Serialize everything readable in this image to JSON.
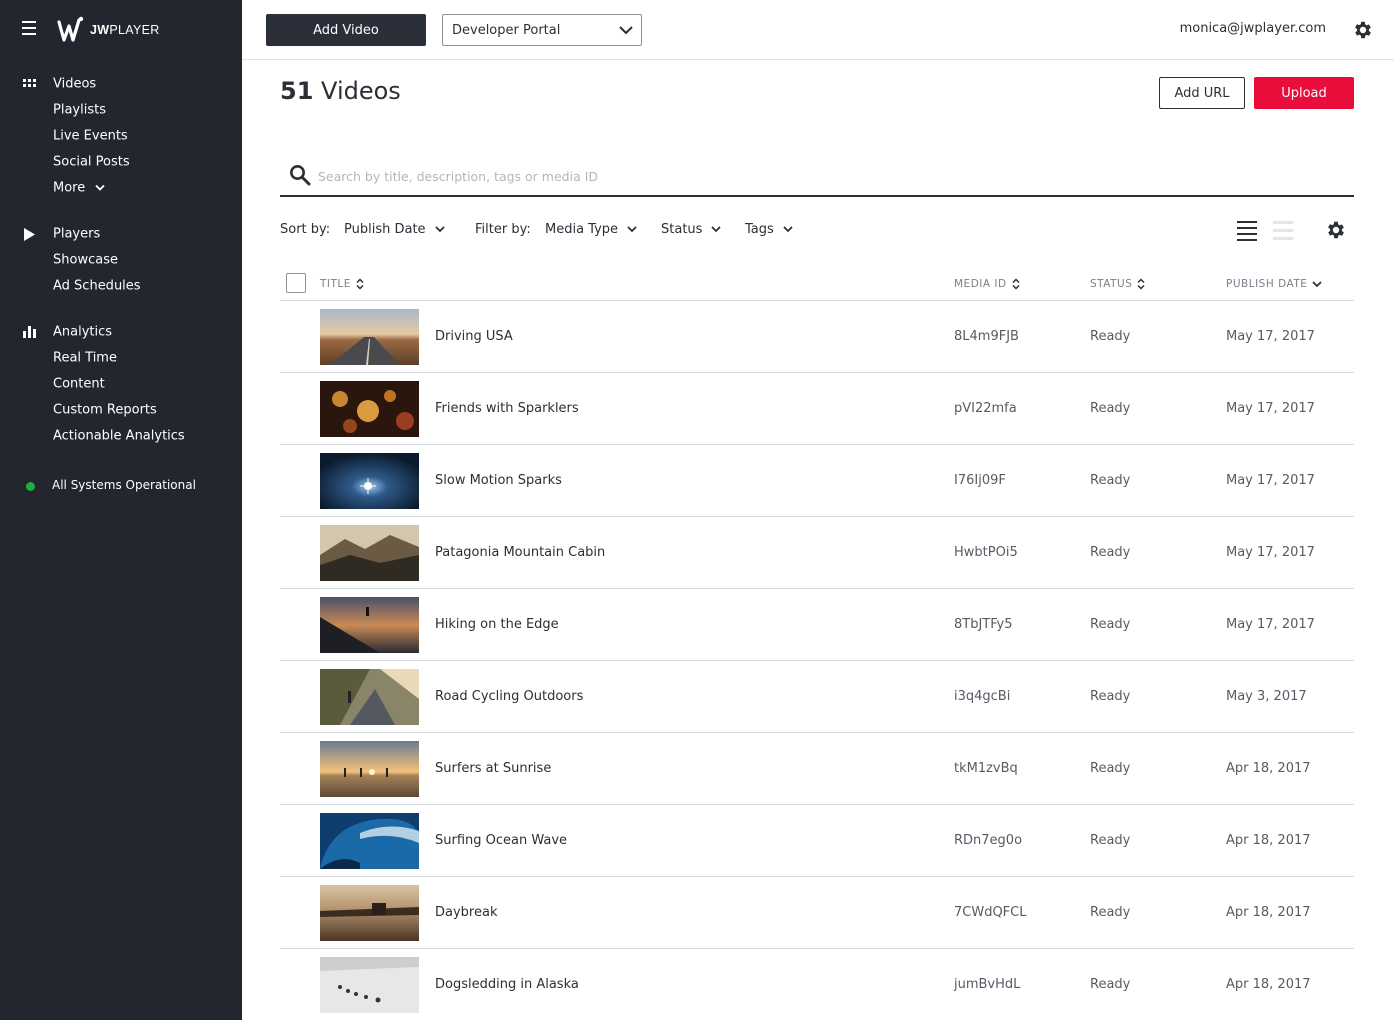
{
  "brand": {
    "logo_text_bold": "JW",
    "logo_text": "PLAYER"
  },
  "sidebar": {
    "groups": [
      {
        "icon": "grid-icon",
        "items": [
          {
            "label": "Videos"
          },
          {
            "label": "Playlists"
          },
          {
            "label": "Live Events"
          },
          {
            "label": "Social Posts"
          },
          {
            "label": "More"
          }
        ]
      },
      {
        "icon": "play-icon",
        "items": [
          {
            "label": "Players"
          },
          {
            "label": "Showcase"
          },
          {
            "label": "Ad Schedules"
          }
        ]
      },
      {
        "icon": "bar-chart-icon",
        "items": [
          {
            "label": "Analytics"
          },
          {
            "label": "Real Time"
          },
          {
            "label": "Content"
          },
          {
            "label": "Custom Reports"
          },
          {
            "label": "Actionable Analytics"
          }
        ]
      }
    ],
    "status": {
      "label": "All Systems Operational",
      "color": "#1fad3d"
    }
  },
  "topbar": {
    "add_video_label": "Add Video",
    "property_value": "Developer Portal",
    "user_email": "monica@jwplayer.com"
  },
  "main": {
    "title_count": "51",
    "title_text": "Videos",
    "add_url_label": "Add URL",
    "upload_label": "Upload",
    "search_placeholder": "Search by title, description, tags or media ID",
    "sort_label": "Sort by:",
    "sort_value": "Publish Date",
    "filter_label": "Filter by:",
    "filters": [
      "Media Type",
      "Status",
      "Tags"
    ]
  },
  "table": {
    "columns": {
      "title": "TITLE",
      "media_id": "MEDIA ID",
      "status": "STATUS",
      "publish_date": "PUBLISH DATE"
    },
    "rows": [
      {
        "title": "Driving USA",
        "media_id": "8L4m9FJB",
        "status": "Ready",
        "date": "May 17, 2017",
        "thumb": "desert-road"
      },
      {
        "title": "Friends with Sparklers",
        "media_id": "pVI22mfa",
        "status": "Ready",
        "date": "May 17, 2017",
        "thumb": "sparklers"
      },
      {
        "title": "Slow Motion Sparks",
        "media_id": "I76Ij09F",
        "status": "Ready",
        "date": "May 17, 2017",
        "thumb": "sparks"
      },
      {
        "title": "Patagonia Mountain Cabin",
        "media_id": "HwbtPOi5",
        "status": "Ready",
        "date": "May 17, 2017",
        "thumb": "mountains"
      },
      {
        "title": "Hiking on the Edge",
        "media_id": "8TbJTFy5",
        "status": "Ready",
        "date": "May 17, 2017",
        "thumb": "hiking"
      },
      {
        "title": "Road Cycling Outdoors",
        "media_id": "i3q4gcBi",
        "status": "Ready",
        "date": "May 3, 2017",
        "thumb": "cycling"
      },
      {
        "title": "Surfers at Sunrise",
        "media_id": "tkM1zvBq",
        "status": "Ready",
        "date": "Apr 18, 2017",
        "thumb": "sunrise-beach"
      },
      {
        "title": "Surfing Ocean Wave",
        "media_id": "RDn7eg0o",
        "status": "Ready",
        "date": "Apr 18, 2017",
        "thumb": "wave"
      },
      {
        "title": "Daybreak",
        "media_id": "7CWdQFCL",
        "status": "Ready",
        "date": "Apr 18, 2017",
        "thumb": "daybreak"
      },
      {
        "title": "Dogsledding in Alaska",
        "media_id": "jumBvHdL",
        "status": "Ready",
        "date": "Apr 18, 2017",
        "thumb": "snow"
      }
    ]
  },
  "colors": {
    "sidebar_bg": "#23262e",
    "primary_dark": "#2b2f39",
    "upload_red": "#ea0c3b",
    "status_green": "#1fad3d"
  }
}
